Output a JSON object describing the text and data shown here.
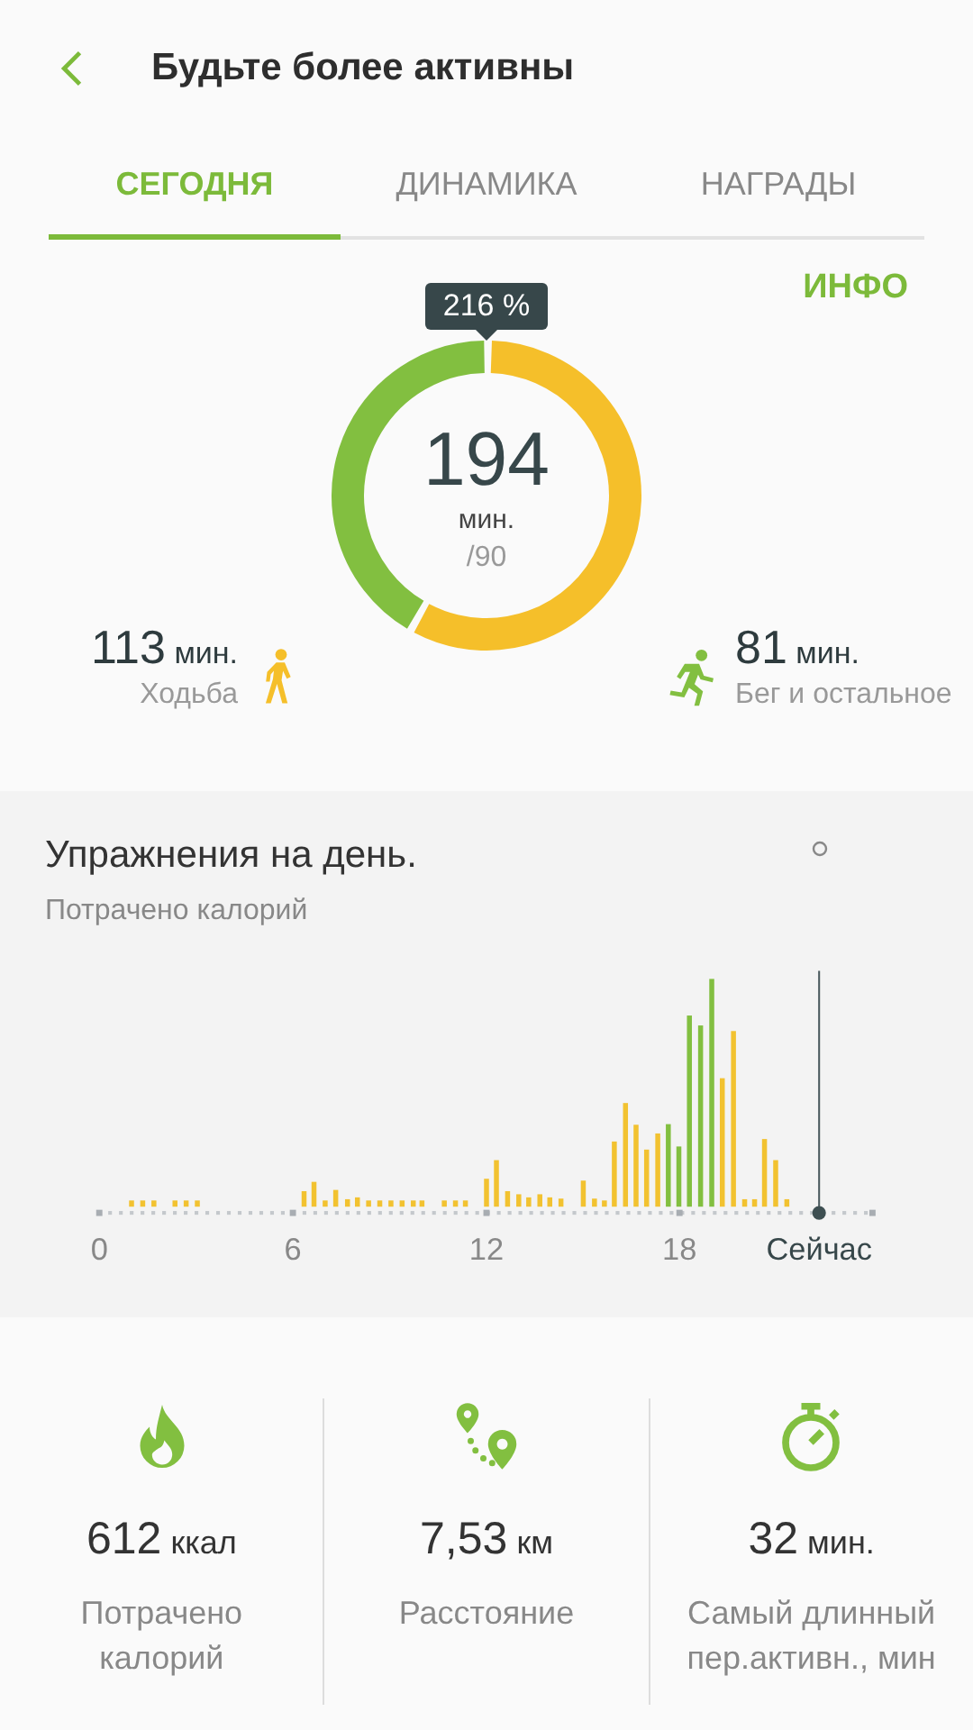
{
  "header": {
    "title": "Будьте более активны"
  },
  "tabs": [
    {
      "label": "СЕГОДНЯ",
      "selected": true
    },
    {
      "label": "ДИНАМИКА",
      "selected": false
    },
    {
      "label": "НАГРАДЫ",
      "selected": false
    }
  ],
  "info_link": "ИНФО",
  "summary": {
    "badge": "216 %",
    "total": "194",
    "unit": "мин.",
    "goal": "/90",
    "activities": [
      {
        "kind": "walking",
        "value": "113",
        "unit": "мин.",
        "label": "Ходьба"
      },
      {
        "kind": "running",
        "value": "81",
        "unit": "мин.",
        "label": "Бег и остальное"
      }
    ]
  },
  "exercise": {
    "title": "Упражнения на день.",
    "subtitle": "Потрачено калорий",
    "axis_labels": [
      "0",
      "6",
      "12",
      "18",
      "Сейчас"
    ]
  },
  "stats": [
    {
      "kind": "calories",
      "value": "612",
      "unit": "ккал",
      "label": "Потрачено калорий"
    },
    {
      "kind": "distance",
      "value": "7,53",
      "unit": "км",
      "label": "Расстояние"
    },
    {
      "kind": "timer",
      "value": "32",
      "unit": "мин.",
      "label": "Самый длинный пер.активн., мин"
    }
  ]
}
